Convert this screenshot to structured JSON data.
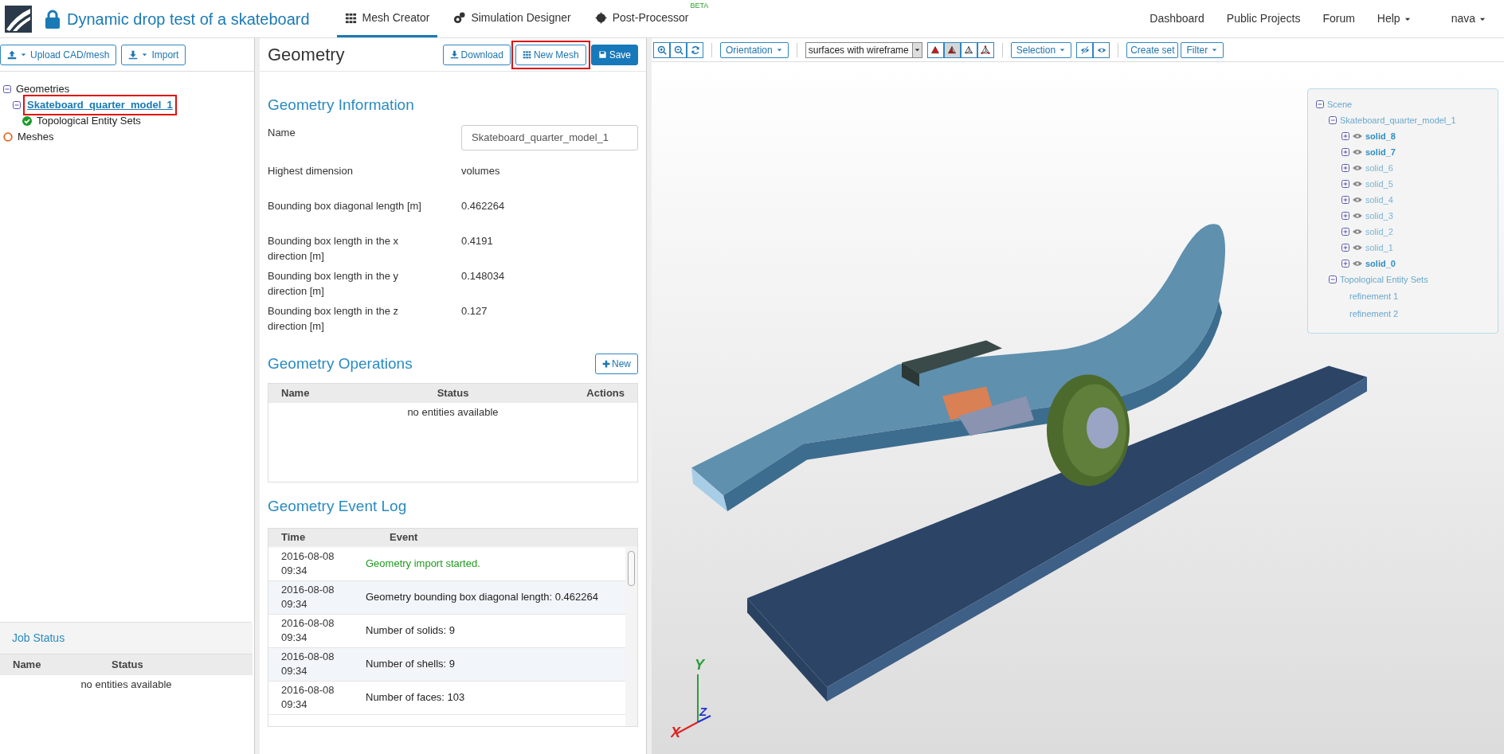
{
  "header": {
    "title": "Dynamic drop test of a skateboard",
    "tabs": [
      {
        "label": "Mesh Creator",
        "kind": "grid",
        "selected": true
      },
      {
        "label": "Simulation Designer",
        "kind": "gears",
        "selected": false
      },
      {
        "label": "Post-Processor",
        "kind": "cog",
        "selected": false,
        "badge": "BETA"
      }
    ],
    "nav": [
      {
        "label": "Dashboard",
        "dropdown": false
      },
      {
        "label": "Public Projects",
        "dropdown": false
      },
      {
        "label": "Forum",
        "dropdown": false
      },
      {
        "label": "Help",
        "dropdown": true
      }
    ],
    "user": "nava"
  },
  "left_panel": {
    "buttons": [
      {
        "label": "Upload CAD/mesh",
        "kind": "upload"
      },
      {
        "label": "Import",
        "kind": "download"
      }
    ],
    "tree": [
      {
        "label": "Geometries",
        "kind": "folder",
        "expanded": true,
        "children": [
          {
            "label": "Skateboard_quarter_model_1",
            "kind": "folder",
            "expanded": true,
            "selected": true,
            "highlighted": true,
            "children": [
              {
                "label": "Topological Entity Sets",
                "kind": "ok"
              }
            ]
          }
        ]
      },
      {
        "label": "Meshes",
        "kind": "empty"
      }
    ],
    "job_status": {
      "title": "Job Status",
      "columns": [
        "Name",
        "Status"
      ],
      "empty_text": "no entities available"
    }
  },
  "geometry_panel": {
    "title": "Geometry",
    "buttons": [
      {
        "label": "Download",
        "kind": "download",
        "primary": false,
        "highlighted": false
      },
      {
        "label": "New Mesh",
        "kind": "grid",
        "primary": false,
        "highlighted": true
      },
      {
        "label": "Save",
        "kind": "save",
        "primary": true,
        "highlighted": false
      }
    ],
    "info": {
      "heading": "Geometry Information",
      "fields": [
        {
          "label": "Name",
          "value": "Skateboard_quarter_model_1",
          "kind": "input"
        },
        {
          "label": "Highest dimension",
          "value": "volumes",
          "kind": "text"
        },
        {
          "label": "Bounding box diagonal length [m]",
          "value": "0.462264",
          "kind": "text"
        },
        {
          "label": "Bounding box length in the x direction [m]",
          "value": "0.4191",
          "kind": "text"
        },
        {
          "label": "Bounding box length in the y direction [m]",
          "value": "0.148034",
          "kind": "text"
        },
        {
          "label": "Bounding box length in the z direction [m]",
          "value": "0.127",
          "kind": "text"
        }
      ]
    },
    "operations": {
      "heading": "Geometry Operations",
      "new_button": "New",
      "columns": [
        "Name",
        "Status",
        "Actions"
      ],
      "empty_text": "no entities available"
    },
    "event_log": {
      "heading": "Geometry Event Log",
      "columns": [
        "Time",
        "Event"
      ],
      "rows": [
        {
          "time": "2016-08-08 09:34",
          "event": "Geometry import started.",
          "kind": "success"
        },
        {
          "time": "2016-08-08 09:34",
          "event": "Geometry bounding box diagonal length: 0.462264",
          "kind": "info"
        },
        {
          "time": "2016-08-08 09:34",
          "event": "Number of solids: 9",
          "kind": "info"
        },
        {
          "time": "2016-08-08 09:34",
          "event": "Number of shells: 9",
          "kind": "info"
        },
        {
          "time": "2016-08-08 09:34",
          "event": "Number of faces: 103",
          "kind": "info"
        }
      ]
    }
  },
  "viewer": {
    "toolbar": {
      "orientation": "Orientation",
      "display_mode": "surfaces with wireframe",
      "render_modes": [
        {
          "selected": false
        },
        {
          "selected": true
        },
        {
          "selected": false
        },
        {
          "selected": false
        }
      ],
      "selection": "Selection",
      "create_set": "Create set",
      "filter": "Filter"
    },
    "scene_tree": {
      "label": "Scene",
      "children": [
        {
          "label": "Skateboard_quarter_model_1",
          "children": [
            {
              "label": "solid_8",
              "bold": true
            },
            {
              "label": "solid_7",
              "bold": true
            },
            {
              "label": "solid_6",
              "bold": false
            },
            {
              "label": "solid_5",
              "bold": false
            },
            {
              "label": "solid_4",
              "bold": false
            },
            {
              "label": "solid_3",
              "bold": false
            },
            {
              "label": "solid_2",
              "bold": false
            },
            {
              "label": "solid_1",
              "bold": false
            },
            {
              "label": "solid_0",
              "bold": true
            }
          ]
        },
        {
          "label": "Topological Entity Sets",
          "children": [
            {
              "label": "refinement 1"
            },
            {
              "label": "refinement 2"
            }
          ]
        }
      ]
    },
    "axes": {
      "x": "X",
      "y": "Y",
      "z": "Z"
    }
  }
}
